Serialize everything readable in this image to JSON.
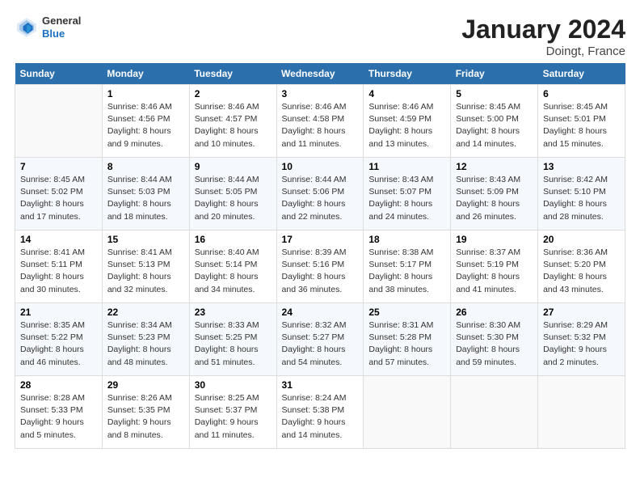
{
  "header": {
    "title": "January 2024",
    "subtitle": "Doingt, France",
    "logo_general": "General",
    "logo_blue": "Blue"
  },
  "days_of_week": [
    "Sunday",
    "Monday",
    "Tuesday",
    "Wednesday",
    "Thursday",
    "Friday",
    "Saturday"
  ],
  "weeks": [
    [
      {
        "day": "",
        "empty": true
      },
      {
        "day": "1",
        "sunrise": "Sunrise: 8:46 AM",
        "sunset": "Sunset: 4:56 PM",
        "daylight": "Daylight: 8 hours and 9 minutes."
      },
      {
        "day": "2",
        "sunrise": "Sunrise: 8:46 AM",
        "sunset": "Sunset: 4:57 PM",
        "daylight": "Daylight: 8 hours and 10 minutes."
      },
      {
        "day": "3",
        "sunrise": "Sunrise: 8:46 AM",
        "sunset": "Sunset: 4:58 PM",
        "daylight": "Daylight: 8 hours and 11 minutes."
      },
      {
        "day": "4",
        "sunrise": "Sunrise: 8:46 AM",
        "sunset": "Sunset: 4:59 PM",
        "daylight": "Daylight: 8 hours and 13 minutes."
      },
      {
        "day": "5",
        "sunrise": "Sunrise: 8:45 AM",
        "sunset": "Sunset: 5:00 PM",
        "daylight": "Daylight: 8 hours and 14 minutes."
      },
      {
        "day": "6",
        "sunrise": "Sunrise: 8:45 AM",
        "sunset": "Sunset: 5:01 PM",
        "daylight": "Daylight: 8 hours and 15 minutes."
      }
    ],
    [
      {
        "day": "7",
        "sunrise": "Sunrise: 8:45 AM",
        "sunset": "Sunset: 5:02 PM",
        "daylight": "Daylight: 8 hours and 17 minutes."
      },
      {
        "day": "8",
        "sunrise": "Sunrise: 8:44 AM",
        "sunset": "Sunset: 5:03 PM",
        "daylight": "Daylight: 8 hours and 18 minutes."
      },
      {
        "day": "9",
        "sunrise": "Sunrise: 8:44 AM",
        "sunset": "Sunset: 5:05 PM",
        "daylight": "Daylight: 8 hours and 20 minutes."
      },
      {
        "day": "10",
        "sunrise": "Sunrise: 8:44 AM",
        "sunset": "Sunset: 5:06 PM",
        "daylight": "Daylight: 8 hours and 22 minutes."
      },
      {
        "day": "11",
        "sunrise": "Sunrise: 8:43 AM",
        "sunset": "Sunset: 5:07 PM",
        "daylight": "Daylight: 8 hours and 24 minutes."
      },
      {
        "day": "12",
        "sunrise": "Sunrise: 8:43 AM",
        "sunset": "Sunset: 5:09 PM",
        "daylight": "Daylight: 8 hours and 26 minutes."
      },
      {
        "day": "13",
        "sunrise": "Sunrise: 8:42 AM",
        "sunset": "Sunset: 5:10 PM",
        "daylight": "Daylight: 8 hours and 28 minutes."
      }
    ],
    [
      {
        "day": "14",
        "sunrise": "Sunrise: 8:41 AM",
        "sunset": "Sunset: 5:11 PM",
        "daylight": "Daylight: 8 hours and 30 minutes."
      },
      {
        "day": "15",
        "sunrise": "Sunrise: 8:41 AM",
        "sunset": "Sunset: 5:13 PM",
        "daylight": "Daylight: 8 hours and 32 minutes."
      },
      {
        "day": "16",
        "sunrise": "Sunrise: 8:40 AM",
        "sunset": "Sunset: 5:14 PM",
        "daylight": "Daylight: 8 hours and 34 minutes."
      },
      {
        "day": "17",
        "sunrise": "Sunrise: 8:39 AM",
        "sunset": "Sunset: 5:16 PM",
        "daylight": "Daylight: 8 hours and 36 minutes."
      },
      {
        "day": "18",
        "sunrise": "Sunrise: 8:38 AM",
        "sunset": "Sunset: 5:17 PM",
        "daylight": "Daylight: 8 hours and 38 minutes."
      },
      {
        "day": "19",
        "sunrise": "Sunrise: 8:37 AM",
        "sunset": "Sunset: 5:19 PM",
        "daylight": "Daylight: 8 hours and 41 minutes."
      },
      {
        "day": "20",
        "sunrise": "Sunrise: 8:36 AM",
        "sunset": "Sunset: 5:20 PM",
        "daylight": "Daylight: 8 hours and 43 minutes."
      }
    ],
    [
      {
        "day": "21",
        "sunrise": "Sunrise: 8:35 AM",
        "sunset": "Sunset: 5:22 PM",
        "daylight": "Daylight: 8 hours and 46 minutes."
      },
      {
        "day": "22",
        "sunrise": "Sunrise: 8:34 AM",
        "sunset": "Sunset: 5:23 PM",
        "daylight": "Daylight: 8 hours and 48 minutes."
      },
      {
        "day": "23",
        "sunrise": "Sunrise: 8:33 AM",
        "sunset": "Sunset: 5:25 PM",
        "daylight": "Daylight: 8 hours and 51 minutes."
      },
      {
        "day": "24",
        "sunrise": "Sunrise: 8:32 AM",
        "sunset": "Sunset: 5:27 PM",
        "daylight": "Daylight: 8 hours and 54 minutes."
      },
      {
        "day": "25",
        "sunrise": "Sunrise: 8:31 AM",
        "sunset": "Sunset: 5:28 PM",
        "daylight": "Daylight: 8 hours and 57 minutes."
      },
      {
        "day": "26",
        "sunrise": "Sunrise: 8:30 AM",
        "sunset": "Sunset: 5:30 PM",
        "daylight": "Daylight: 8 hours and 59 minutes."
      },
      {
        "day": "27",
        "sunrise": "Sunrise: 8:29 AM",
        "sunset": "Sunset: 5:32 PM",
        "daylight": "Daylight: 9 hours and 2 minutes."
      }
    ],
    [
      {
        "day": "28",
        "sunrise": "Sunrise: 8:28 AM",
        "sunset": "Sunset: 5:33 PM",
        "daylight": "Daylight: 9 hours and 5 minutes."
      },
      {
        "day": "29",
        "sunrise": "Sunrise: 8:26 AM",
        "sunset": "Sunset: 5:35 PM",
        "daylight": "Daylight: 9 hours and 8 minutes."
      },
      {
        "day": "30",
        "sunrise": "Sunrise: 8:25 AM",
        "sunset": "Sunset: 5:37 PM",
        "daylight": "Daylight: 9 hours and 11 minutes."
      },
      {
        "day": "31",
        "sunrise": "Sunrise: 8:24 AM",
        "sunset": "Sunset: 5:38 PM",
        "daylight": "Daylight: 9 hours and 14 minutes."
      },
      {
        "day": "",
        "empty": true
      },
      {
        "day": "",
        "empty": true
      },
      {
        "day": "",
        "empty": true
      }
    ]
  ]
}
